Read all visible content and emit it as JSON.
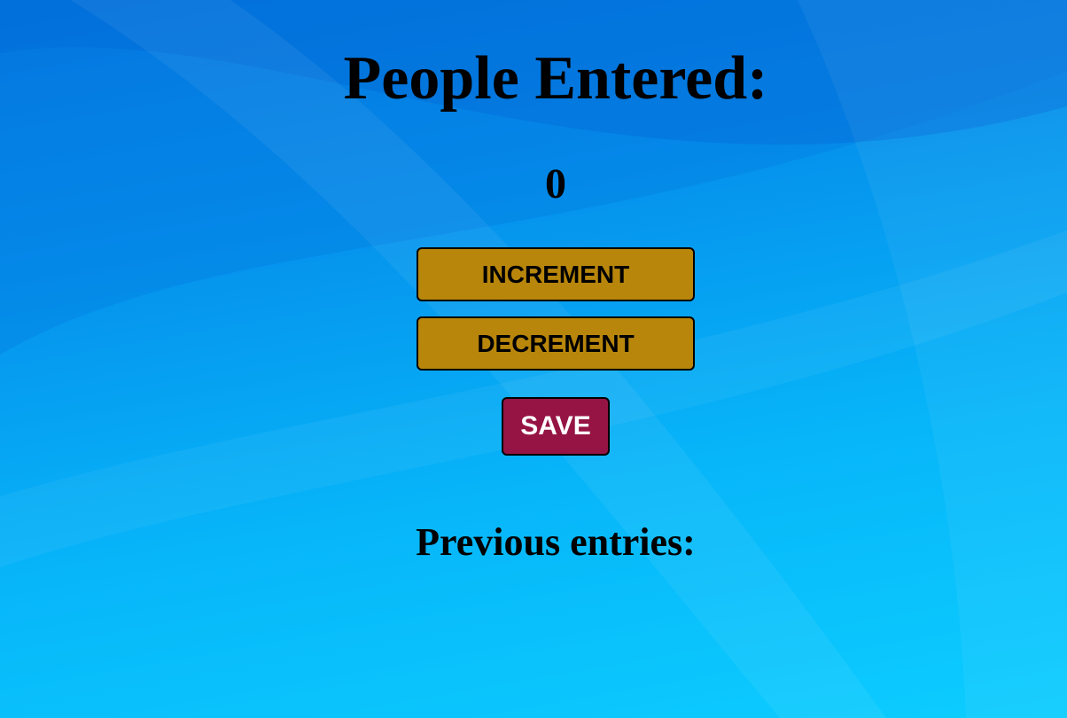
{
  "title": "People Entered:",
  "count": "0",
  "buttons": {
    "increment": "INCREMENT",
    "decrement": "DECREMENT",
    "save": "SAVE"
  },
  "previous_entries": {
    "heading": "Previous entries:",
    "entries": ""
  },
  "colors": {
    "background": "#0590ec",
    "button_gold": "#b8860b",
    "button_save": "#961444",
    "save_text": "#ffffff"
  }
}
